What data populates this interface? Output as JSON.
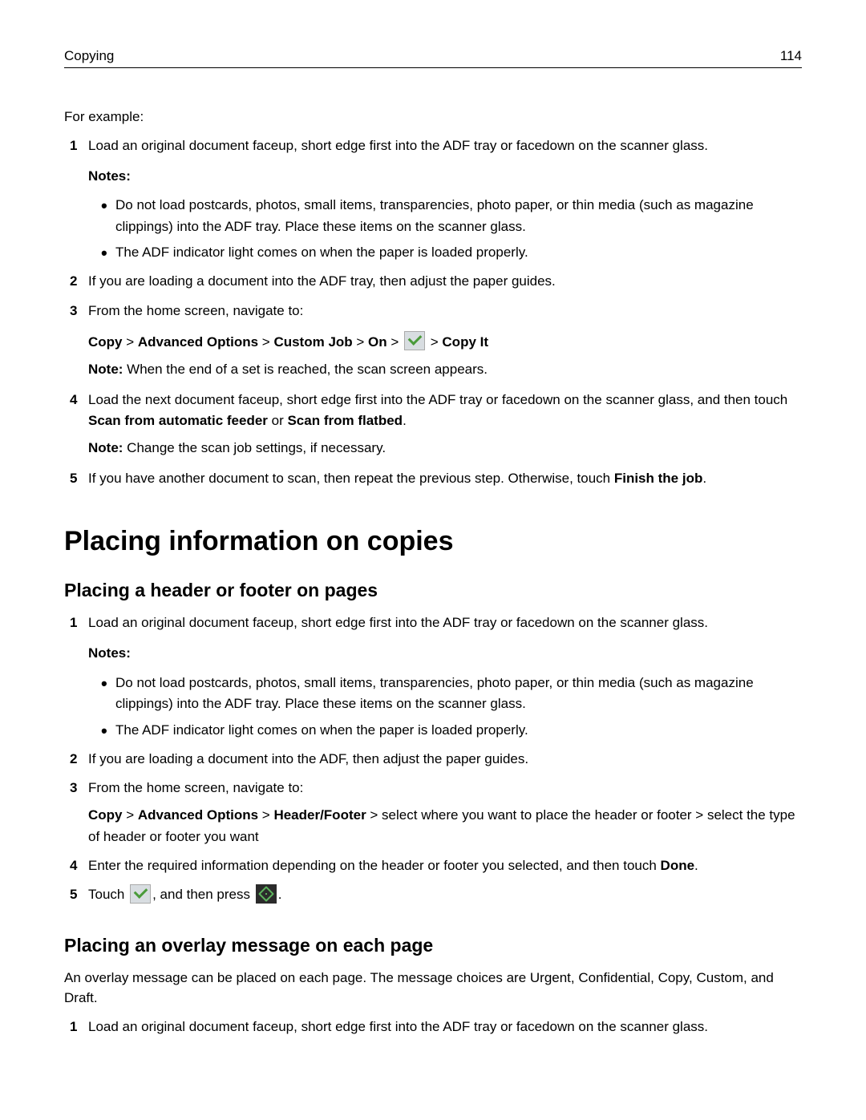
{
  "header": {
    "section": "Copying",
    "page": "114"
  },
  "intro": "For example:",
  "sectionA": {
    "step1": "Load an original document faceup, short edge first into the ADF tray or facedown on the scanner glass.",
    "notesLabel": "Notes:",
    "notes": {
      "a": "Do not load postcards, photos, small items, transparencies, photo paper, or thin media (such as magazine clippings) into the ADF tray. Place these items on the scanner glass.",
      "b": "The ADF indicator light comes on when the paper is loaded properly."
    },
    "step2": "If you are loading a document into the ADF tray, then adjust the paper guides.",
    "step3": "From the home screen, navigate to:",
    "nav": {
      "copy": "Copy",
      "advOpt": "Advanced Options",
      "customJob": "Custom Job",
      "on": "On",
      "copyIt": "Copy It",
      "sep": " > "
    },
    "note3_label": "Note:",
    "note3_text": " When the end of a set is reached, the scan screen appears.",
    "step4_a": "Load the next document faceup, short edge first into the ADF tray or facedown on the scanner glass, and then touch ",
    "step4_b1": "Scan from automatic feeder",
    "step4_or": " or ",
    "step4_b2": "Scan from flatbed",
    "step4_end": ".",
    "note4_label": "Note:",
    "note4_text": " Change the scan job settings, if necessary.",
    "step5_a": "If you have another document to scan, then repeat the previous step. Otherwise, touch ",
    "step5_b": "Finish the job",
    "step5_end": "."
  },
  "heading1": "Placing information on copies",
  "heading2a": "Placing a header or footer on pages",
  "sectionB": {
    "step1": "Load an original document faceup, short edge first into the ADF tray or facedown on the scanner glass.",
    "notesLabel": "Notes:",
    "notes": {
      "a": "Do not load postcards, photos, small items, transparencies, photo paper, or thin media (such as magazine clippings) into the ADF tray. Place these items on the scanner glass.",
      "b": "The ADF indicator light comes on when the paper is loaded properly."
    },
    "step2": "If you are loading a document into the ADF, then adjust the paper guides.",
    "step3": "From the home screen, navigate to:",
    "nav": {
      "copy": "Copy",
      "advOpt": "Advanced Options",
      "headerFooter": "Header/Footer",
      "tail": " > select where you want to place the header or footer > select the type of header or footer you want",
      "sep": " > "
    },
    "step4_a": "Enter the required information depending on the header or footer you selected, and then touch ",
    "step4_b": "Done",
    "step4_end": ".",
    "step5_a": "Touch ",
    "step5_mid": ", and then press ",
    "step5_end": "."
  },
  "heading2b": "Placing an overlay message on each page",
  "sectionC": {
    "intro": "An overlay message can be placed on each page. The message choices are Urgent, Confidential, Copy, Custom, and Draft.",
    "step1": "Load an original document faceup, short edge first into the ADF tray or facedown on the scanner glass."
  }
}
